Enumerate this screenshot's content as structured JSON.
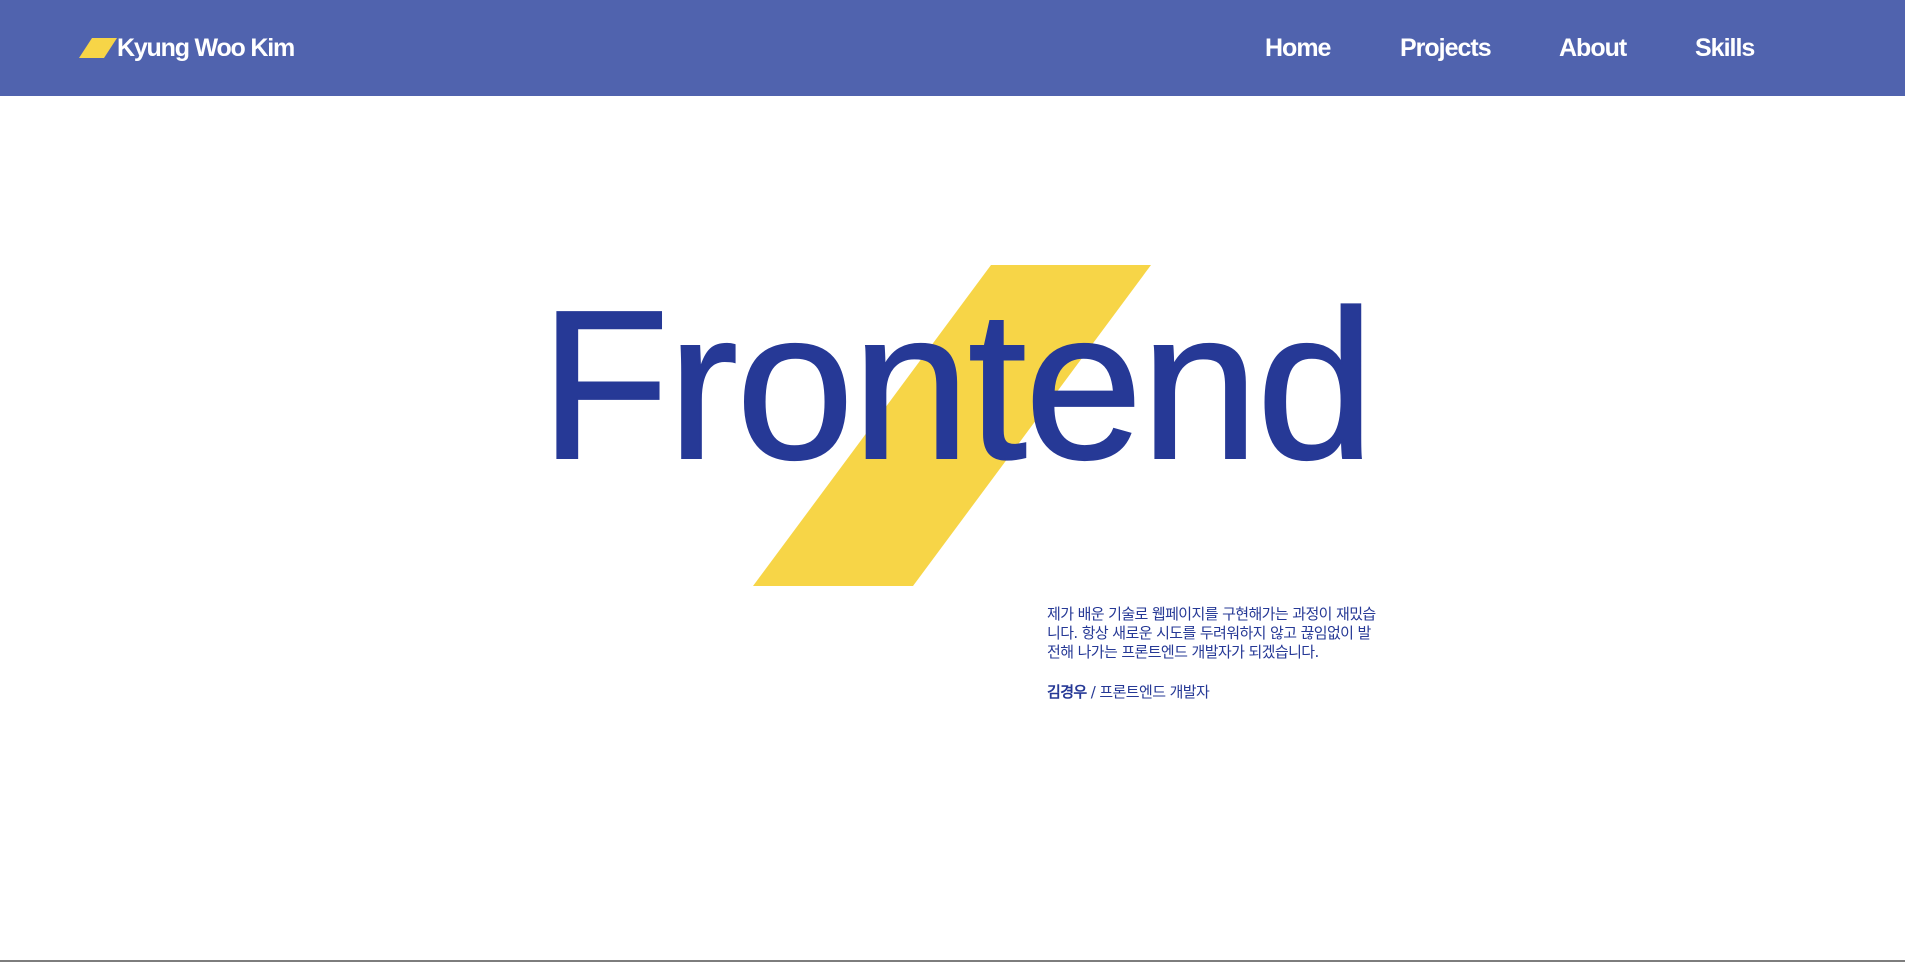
{
  "colors": {
    "header_bg": "#5063ae",
    "accent_yellow": "#f7d547",
    "brand_blue": "#263996",
    "nav_text": "#ffffff"
  },
  "header": {
    "logo_icon": "yellow-slash-mark",
    "logo_text": "Kyung Woo Kim",
    "nav": [
      {
        "label": "Home"
      },
      {
        "label": "Projects"
      },
      {
        "label": "About"
      },
      {
        "label": "Skills"
      }
    ]
  },
  "hero": {
    "title": "Frontend",
    "decoration": "yellow-slash-shape",
    "intro_lines": [
      "제가 배운 기술로 웹페이지를 구현해가는 과정이 재밌습",
      "니다. 항상 새로운 시도를 두려워하지 않고 끊임없이 발",
      "전해 나가는 프론트엔드 개발자가 되겠습니다."
    ],
    "signature": {
      "name": "김경우",
      "separator": " / ",
      "role": "프론트엔드 개발자"
    }
  }
}
